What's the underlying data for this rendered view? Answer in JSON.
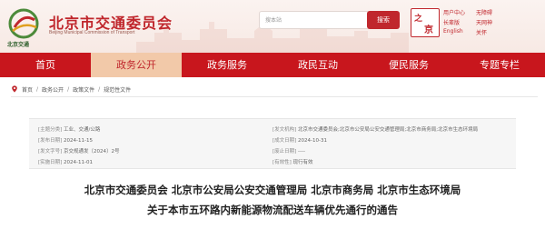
{
  "header": {
    "title": "北京市交通委员会",
    "subtitle": "Beijing Municipal Commission of Transport",
    "logo_text": "北京交通",
    "search_placeholder": "搜本站",
    "search_button": "搜索",
    "emblem_text_1": "之",
    "emblem_text_2": "京",
    "links": [
      {
        "label": "用户中心"
      },
      {
        "label": "无障碍"
      },
      {
        "label": "长辈版"
      },
      {
        "label": "天网神"
      },
      {
        "label": "English"
      },
      {
        "label": "关怀"
      }
    ]
  },
  "nav": {
    "items": [
      {
        "label": "首页"
      },
      {
        "label": "政务公开"
      },
      {
        "label": "政务服务"
      },
      {
        "label": "政民互动"
      },
      {
        "label": "便民服务"
      },
      {
        "label": "专题专栏"
      }
    ],
    "active_index": 1
  },
  "breadcrumb": {
    "items": [
      "首页",
      "政务公开",
      "政策文件",
      "规范性文件"
    ],
    "separator": "/"
  },
  "meta": {
    "left": [
      {
        "key": "[主题分类]",
        "value": "工业、交通/公路"
      },
      {
        "key": "[发布日期]",
        "value": "2024-11-15"
      },
      {
        "key": "[发文字号]",
        "value": "京交规通发〔2024〕2号"
      },
      {
        "key": "[实施日期]",
        "value": "2024-11-01"
      }
    ],
    "right": [
      {
        "key": "[发文机构]",
        "value": "北京市交通委员会;北京市公安局公安交通管理局;北京市商务局;北京市生态环境局"
      },
      {
        "key": "[成文日期]",
        "value": "2024-10-31"
      },
      {
        "key": "[废止日期]",
        "value": "----"
      },
      {
        "key": "[有效性]",
        "value": "现行有效"
      }
    ]
  },
  "document": {
    "title_line_1": "北京市交通委员会 北京市公安局公安交通管理局 北京市商务局 北京市生态环境局",
    "title_line_2": "关于本市五环路内新能源物流配送车辆优先通行的通告"
  },
  "colors": {
    "brand_red": "#c8161d",
    "active_tab": "#f2c9a9"
  }
}
